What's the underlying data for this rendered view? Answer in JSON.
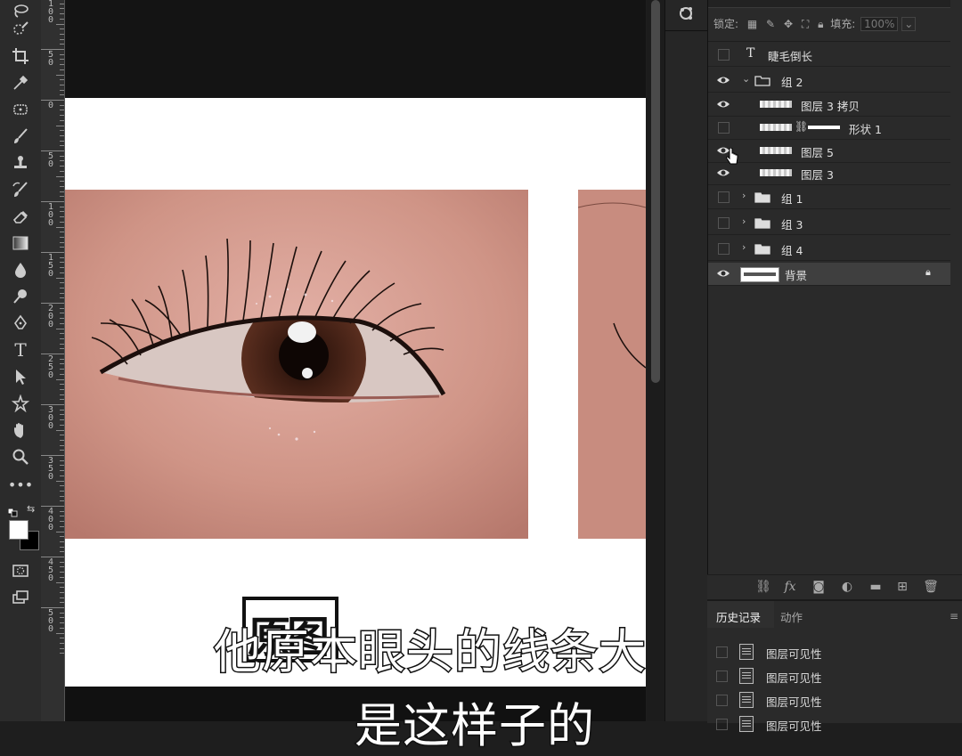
{
  "layers_panel": {
    "lock_label": "锁定:",
    "fill_label": "填充:",
    "fill_value": "100%",
    "layers": [
      {
        "name": "睫毛倒长",
        "visible": false,
        "kind": "text",
        "indent": 0
      },
      {
        "name": "组 2",
        "visible": true,
        "kind": "group-open",
        "indent": 0
      },
      {
        "name": "图层 3 拷贝",
        "visible": true,
        "kind": "layer",
        "indent": 1
      },
      {
        "name": "形状 1",
        "visible": false,
        "kind": "shape",
        "indent": 1
      },
      {
        "name": "图层 5",
        "visible": true,
        "kind": "layer",
        "indent": 1
      },
      {
        "name": "图层 3",
        "visible": true,
        "kind": "layer",
        "indent": 1
      },
      {
        "name": "组 1",
        "visible": false,
        "kind": "group",
        "indent": 0
      },
      {
        "name": "组 3",
        "visible": false,
        "kind": "group",
        "indent": 0
      },
      {
        "name": "组 4",
        "visible": false,
        "kind": "group",
        "indent": 0
      },
      {
        "name": "背景",
        "visible": true,
        "kind": "background",
        "indent": 0,
        "locked": true
      }
    ]
  },
  "history_panel": {
    "tabs": [
      "历史记录",
      "动作"
    ],
    "items": [
      "图层可见性",
      "图层可见性",
      "图层可见性",
      "图层可见性"
    ]
  },
  "ruler": {
    "labels": [
      "1\n0\n0",
      "5\n0",
      "0",
      "5\n0",
      "1\n0\n0",
      "1\n5\n0",
      "2\n0\n0",
      "2\n5\n0",
      "3\n0\n0",
      "3\n5\n0",
      "4\n0\n0",
      "4\n5\n0",
      "5\n0\n0"
    ]
  },
  "canvas": {
    "stamp_text": "原图"
  },
  "subtitles": {
    "line1": "他原本眼头的线条大概",
    "line2": "是这样子的"
  },
  "colors": {
    "panel_bg": "#2a2a2a",
    "canvas_bg": "#141414",
    "selected_row": "#3f3f3f"
  }
}
